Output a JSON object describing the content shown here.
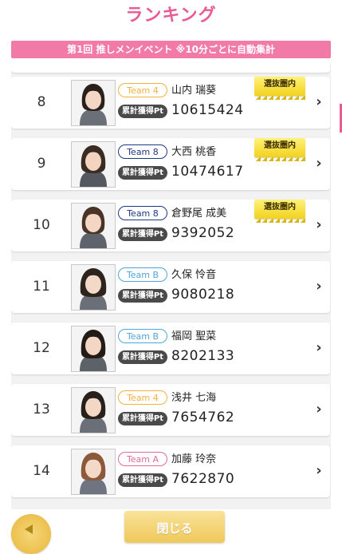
{
  "page": {
    "title": "ランキング"
  },
  "event_banner": "第1回 推しメンイベント ※10分ごとに自動集計",
  "points_label": "累計獲得Pt",
  "selection_badge": "選抜圏内",
  "close_label": "閉じる",
  "colors": {
    "accent_pink": "#ea5b95",
    "team4": "#f2b23d",
    "team8": "#1f3a83",
    "teamB": "#4fa6d9",
    "teamA": "#e06b9a",
    "badge_gold": "#f2d21c"
  },
  "icons": {
    "chevron": "chevron-right-icon",
    "back": "back-arrow-icon"
  },
  "ranking": [
    {
      "rank": "8",
      "team": "Team 4",
      "team_key": "t4",
      "name": "山内 瑞葵",
      "points": "10615424",
      "badge": true
    },
    {
      "rank": "9",
      "team": "Team 8",
      "team_key": "t8",
      "name": "大西 桃香",
      "points": "10474617",
      "badge": true
    },
    {
      "rank": "10",
      "team": "Team 8",
      "team_key": "t8",
      "name": "倉野尾 成美",
      "points": "9392052",
      "badge": true
    },
    {
      "rank": "11",
      "team": "Team B",
      "team_key": "tB",
      "name": "久保 怜音",
      "points": "9080218",
      "badge": false
    },
    {
      "rank": "12",
      "team": "Team B",
      "team_key": "tB",
      "name": "福岡 聖菜",
      "points": "8202133",
      "badge": false
    },
    {
      "rank": "13",
      "team": "Team 4",
      "team_key": "t4",
      "name": "浅井 七海",
      "points": "7654762",
      "badge": false
    },
    {
      "rank": "14",
      "team": "Team A",
      "team_key": "tA",
      "name": "加藤 玲奈",
      "points": "7622870",
      "badge": false
    }
  ]
}
